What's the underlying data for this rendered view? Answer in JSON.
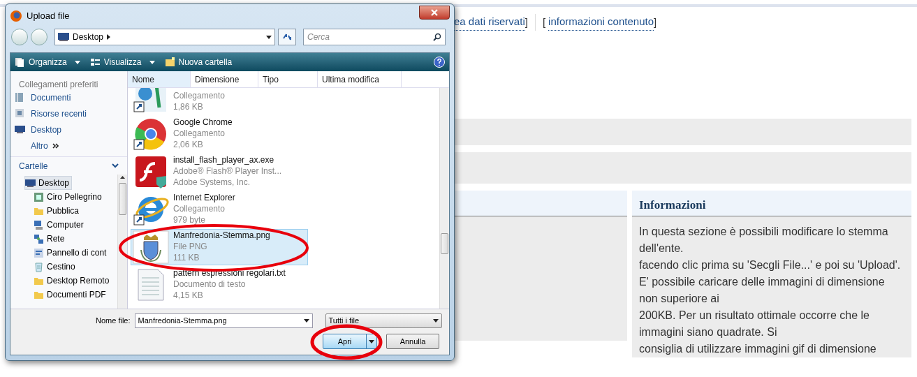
{
  "page": {
    "nav_links": [
      {
        "link": "ea dati riservati",
        "close": "]"
      },
      {
        "open": "[",
        "link": "informazioni contenuto",
        "close": "]"
      }
    ],
    "info_panel": {
      "title": "Informazioni",
      "paragraphs": [
        "In questa sezione è possibili modificare lo stemma dell'ente.",
        "facendo clic prima su 'Secgli File...' e poi su 'Upload'.",
        "E' possibile caricare delle immagini di dimensione non superiore ai",
        "200KB. Per un risultato ottimale occorre che le immagini siano quadrate. Si",
        "consiglia di utilizzare immagini gif di dimensione"
      ]
    }
  },
  "dialog": {
    "title": "Upload file",
    "address": "Desktop",
    "search": {
      "placeholder": "Cerca"
    },
    "toolbar": [
      "Organizza",
      "Visualizza",
      "Nuova cartella"
    ],
    "favorites": {
      "heading": "Collegamenti preferiti",
      "items": [
        "Documenti",
        "Risorse recenti",
        "Desktop"
      ],
      "more": "Altro"
    },
    "folders": {
      "heading": "Cartelle",
      "tree": [
        {
          "label": "Desktop",
          "kind": "desktop",
          "selected": true,
          "children": [
            {
              "label": "Ciro Pellegrino",
              "kind": "user",
              "selected": false
            },
            {
              "label": "Pubblica",
              "kind": "folder",
              "selected": false
            },
            {
              "label": "Computer",
              "kind": "computer",
              "selected": false
            },
            {
              "label": "Rete",
              "kind": "network",
              "selected": false
            },
            {
              "label": "Pannello di cont",
              "kind": "control",
              "selected": false
            },
            {
              "label": "Cestino",
              "kind": "bin",
              "selected": false
            },
            {
              "label": "Desktop Remoto",
              "kind": "folder",
              "selected": false
            },
            {
              "label": "Documenti PDF",
              "kind": "folder",
              "selected": false
            }
          ]
        }
      ]
    },
    "columns": [
      "Nome",
      "Dimensione",
      "Tipo",
      "Ultima modifica"
    ],
    "files": [
      {
        "kind": "shortcut",
        "type": "Collegamento",
        "detail": "1,86 KB",
        "selected": false
      },
      {
        "kind": "chrome",
        "name": "Google Chrome",
        "type": "Collegamento",
        "detail": "2,06 KB",
        "selected": false
      },
      {
        "kind": "flash",
        "name": "install_flash_player_ax.exe",
        "type": "Adobe® Flash® Player Inst...",
        "detail": "Adobe Systems, Inc.",
        "selected": false
      },
      {
        "kind": "explorer",
        "name": "Internet Explorer",
        "type": "Collegamento",
        "detail": "979 byte",
        "selected": false
      },
      {
        "kind": "image",
        "name": "Manfredonia-Stemma.png",
        "type": "File PNG",
        "detail": "111 KB",
        "selected": true
      },
      {
        "kind": "text",
        "name": "pattern espressioni regolari.txt",
        "type": "Documento di testo",
        "detail": "4,15 KB",
        "selected": false
      }
    ],
    "filename": {
      "label": "Nome file:",
      "value": "Manfredonia-Stemma.png"
    },
    "filetype": "Tutti i file",
    "buttons": [
      "Apri",
      "Annulla"
    ]
  }
}
